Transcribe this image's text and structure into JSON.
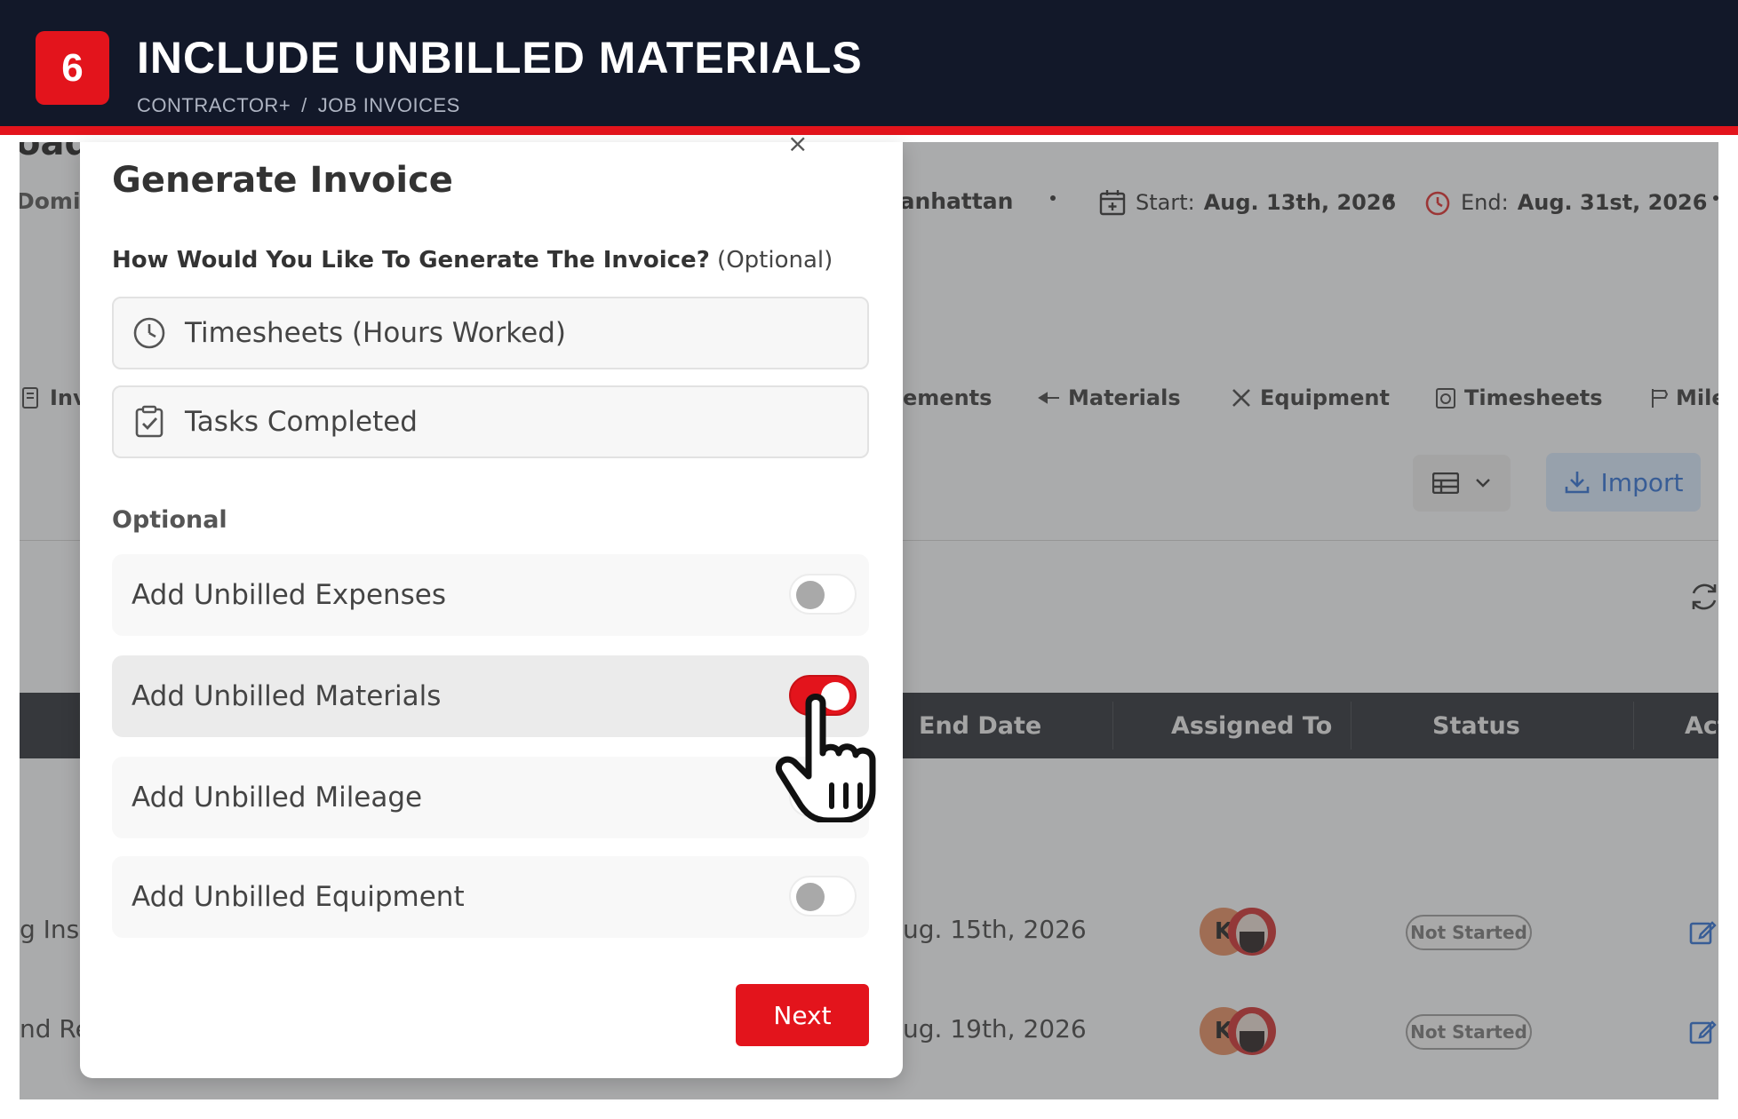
{
  "banner": {
    "step_number": "6",
    "title": "INCLUDE UNBILLED MATERIALS",
    "breadcrumb": [
      "CONTRACTOR+",
      "/",
      "JOB INVOICES"
    ]
  },
  "background": {
    "partial_heading": "oad",
    "partial_owner": "Domin",
    "location": "lanhattan",
    "start_label": "Start:",
    "start_value": "Aug. 13th, 2026",
    "end_label": "End:",
    "end_value": "Aug. 31st, 2026",
    "tabs": [
      {
        "label": "Inv",
        "icon": "invoice-icon"
      },
      {
        "label": "ements",
        "icon": ""
      },
      {
        "label": "Materials",
        "icon": "materials-icon"
      },
      {
        "label": "Equipment",
        "icon": "equipment-icon"
      },
      {
        "label": "Timesheets",
        "icon": "timesheets-icon"
      },
      {
        "label": "Mile",
        "icon": "mileage-icon"
      }
    ],
    "import_label": "Import",
    "table_headers": [
      "End Date",
      "Assigned To",
      "Status",
      "Act"
    ],
    "rows": [
      {
        "partial_name": "g Inst",
        "end_date": "ug. 15th, 2026",
        "avatar_initial": "K",
        "status": "Not Started"
      },
      {
        "partial_name": "nd Re",
        "end_date": "ug. 19th, 2026",
        "avatar_initial": "K",
        "status": "Not Started"
      }
    ]
  },
  "modal": {
    "close_symbol": "×",
    "title": "Generate Invoice",
    "question": "How Would You Like To Generate The Invoice?",
    "question_optional": "(Optional)",
    "choices": [
      {
        "label": "Timesheets (Hours Worked)",
        "icon": "clock-icon"
      },
      {
        "label": "Tasks Completed",
        "icon": "clipboard-check-icon"
      }
    ],
    "optional_heading": "Optional",
    "options": [
      {
        "label": "Add Unbilled Expenses",
        "enabled": false
      },
      {
        "label": "Add Unbilled Materials",
        "enabled": true
      },
      {
        "label": "Add Unbilled Mileage",
        "enabled": false
      },
      {
        "label": "Add Unbilled Equipment",
        "enabled": false
      }
    ],
    "next_label": "Next"
  },
  "colors": {
    "brand_red": "#e3141c",
    "banner_bg": "#121829",
    "table_header_bg": "#2c2f36",
    "import_blue": "#2f6fd0"
  }
}
